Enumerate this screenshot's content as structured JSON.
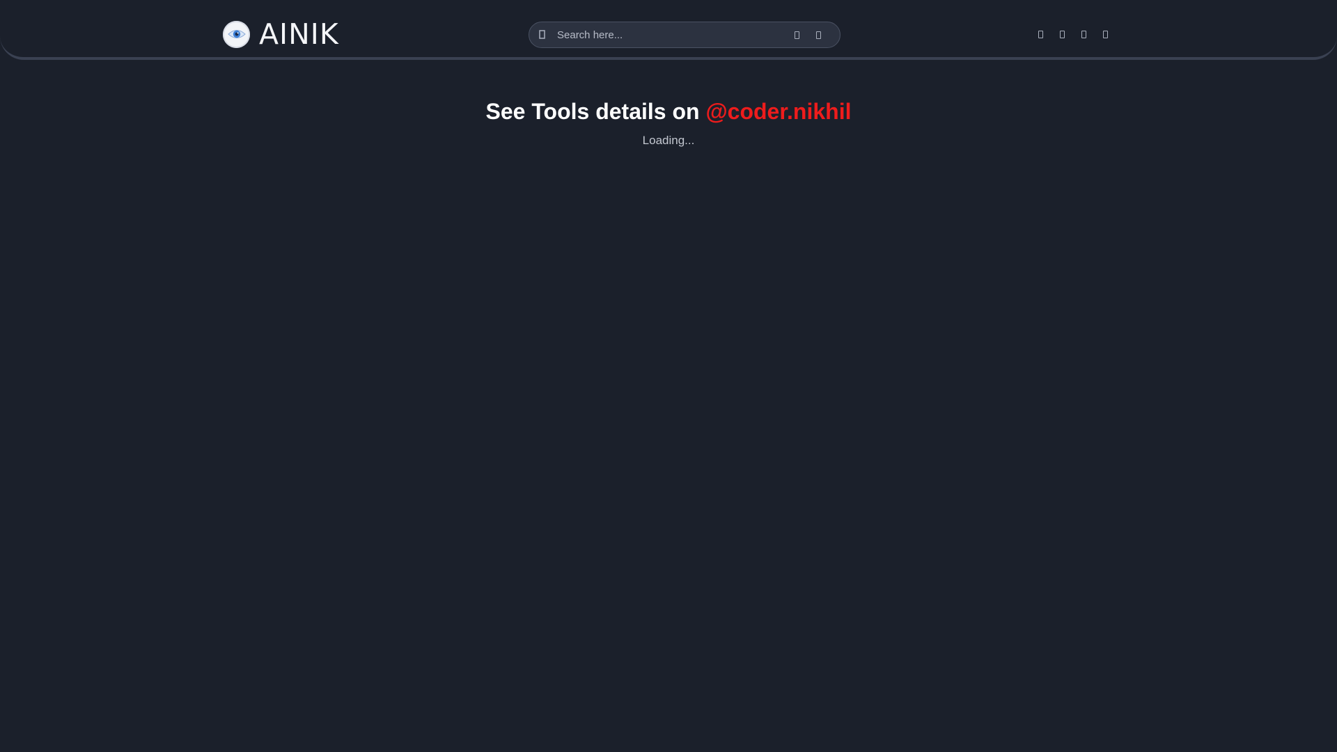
{
  "header": {
    "brand_name": "AINIK",
    "search": {
      "placeholder": "Search here...",
      "value": "",
      "icon": "search-icon",
      "actions": [
        {
          "icon": "microphone-icon"
        },
        {
          "icon": "camera-icon"
        }
      ]
    },
    "nav_icons": [
      {
        "icon": "home-icon"
      },
      {
        "icon": "category-icon"
      },
      {
        "icon": "bookmark-icon"
      },
      {
        "icon": "menu-icon"
      }
    ]
  },
  "main": {
    "heading_prefix": "See Tools details on",
    "heading_link": "@coder.nikhil",
    "status_text": "Loading..."
  },
  "colors": {
    "background": "#1b202b",
    "link_accent": "#ee1c1c",
    "search_bg": "#2c3240",
    "header_border": "#3a4152"
  }
}
